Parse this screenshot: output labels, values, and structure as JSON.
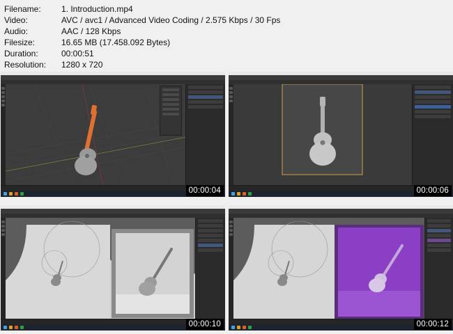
{
  "info": [
    {
      "label": "Filename:",
      "value": "1. Introduction.mp4"
    },
    {
      "label": "Video:",
      "value": "AVC / avc1 / Advanced Video Coding / 2.575 Kbps / 30 Fps"
    },
    {
      "label": "Audio:",
      "value": "AAC / 128 Kbps"
    },
    {
      "label": "Filesize:",
      "value": "16.65 MB (17.458.092 Bytes)"
    },
    {
      "label": "Duration:",
      "value": "00:00:51"
    },
    {
      "label": "Resolution:",
      "value": "1280 x 720"
    }
  ],
  "thumbnails": [
    {
      "timestamp": "00:00:04",
      "scene": "wireframe-guitar-grid"
    },
    {
      "timestamp": "00:00:06",
      "scene": "guitar-camera-view"
    },
    {
      "timestamp": "00:00:10",
      "scene": "studio-backdrop-render-grey"
    },
    {
      "timestamp": "00:00:12",
      "scene": "studio-backdrop-render-purple"
    }
  ],
  "colors": {
    "render_purple": "#8a3fc4",
    "selection_orange": "#e07030",
    "camera_frame": "#c8a040"
  }
}
